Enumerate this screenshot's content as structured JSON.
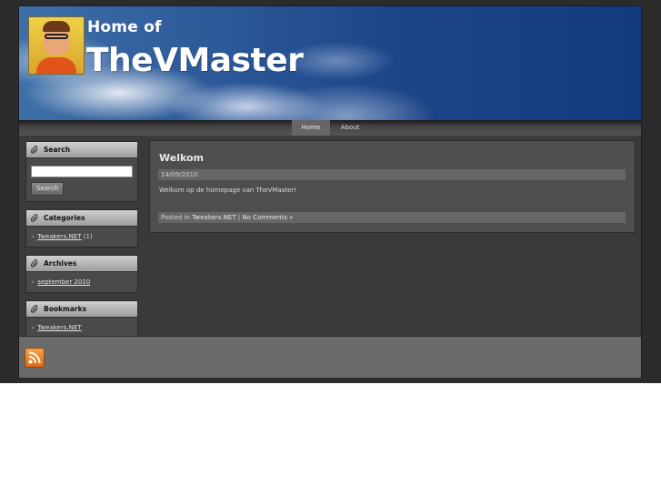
{
  "header": {
    "title_small": "Home of",
    "title_big": "TheVMaster"
  },
  "nav": {
    "items": [
      {
        "label": "Home",
        "active": true
      },
      {
        "label": "About",
        "active": false
      }
    ]
  },
  "sidebar": {
    "search": {
      "title": "Search",
      "button_label": "Search",
      "value": ""
    },
    "categories": {
      "title": "Categories",
      "items": [
        {
          "label": "Tweakers.NET",
          "count": "(1)"
        }
      ]
    },
    "archives": {
      "title": "Archives",
      "items": [
        {
          "label": "september 2010"
        }
      ]
    },
    "bookmarks": {
      "title": "Bookmarks",
      "items": [
        {
          "label": "Tweakers.NET"
        }
      ]
    }
  },
  "post": {
    "title": "Welkom",
    "date": "14/09/2010",
    "body": "Welkom op de homepage van TheVMaster!",
    "posted_in_label": "Posted in",
    "category": "Tweakers.NET",
    "separator": "|",
    "comments": "No Comments »"
  },
  "footer": {
    "icon": "rss-icon"
  },
  "colors": {
    "page_bg": "#2b2b2b",
    "panel_bg": "#4e4e4e",
    "header_blue": "#1d4589",
    "footer_bg": "#6a6a6a",
    "rss_orange": "#e06a10"
  }
}
